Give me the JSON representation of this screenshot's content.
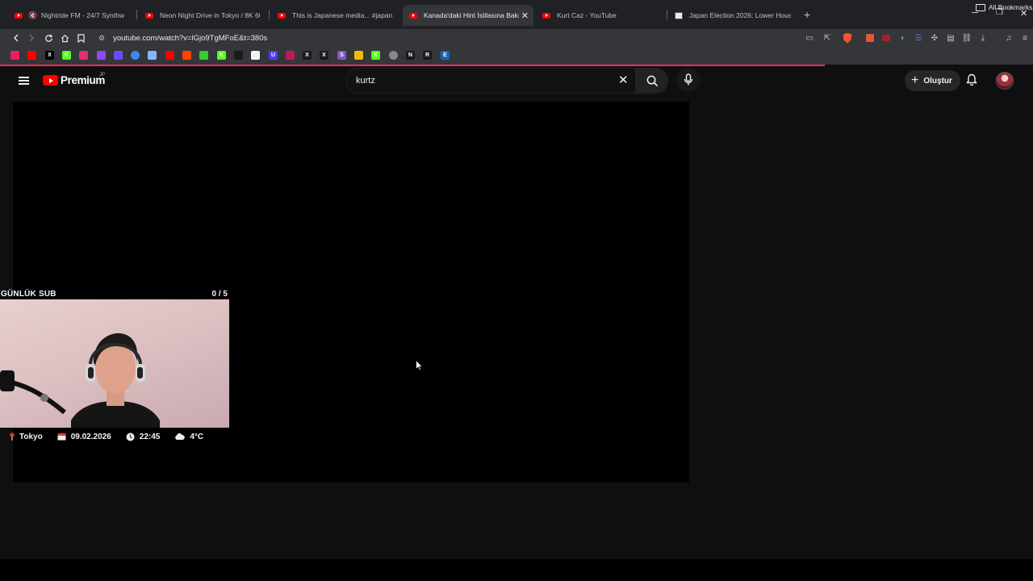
{
  "browser": {
    "tabs": [
      {
        "title": "Nightride FM - 24/7 Synthwave R",
        "muted": true
      },
      {
        "title": "Neon Night Drive in Tokyo / 8K 60fps"
      },
      {
        "title": "This is Japanese media... #japan #jap"
      },
      {
        "title": "Kanada'daki Hint İstilasına Bakış",
        "active": true
      },
      {
        "title": "Kurt Caz - YouTube"
      },
      {
        "title": "Japan Election 2026: Lower House Ele"
      }
    ],
    "url": "youtube.com/watch?v=lGjo9TgMFoE&t=380s",
    "all_bookmarks_label": "All Bookmarks",
    "bookmark_icons": [
      "youtube-music-icon",
      "youtube-icon",
      "x-icon",
      "kick-icon",
      "instagram-icon",
      "twitch-icon",
      "proton-mail-icon",
      "chrome-icon",
      "sparkle-icon",
      "youtube-icon",
      "reddit-icon",
      "drop-icon",
      "kick-icon",
      "terminal-icon",
      "diamond-icon",
      "u-icon",
      "chat-icon",
      "x-icon",
      "x-icon",
      "s-icon",
      "crypto-icon",
      "k-icon",
      "globe-icon",
      "n-icon",
      "r-icon",
      "e-icon"
    ]
  },
  "youtube": {
    "logo_text": "Premium",
    "region": "JP",
    "search_value": "kurtz",
    "create_label": "Oluştur"
  },
  "overlay": {
    "title": "GÜNLÜK SUB",
    "count": "0 / 5",
    "location": "Tokyo",
    "date": "09.02.2026",
    "time": "22:45",
    "temperature": "4°C"
  },
  "colors": {
    "accent": "#ff0000",
    "load_bar": "#ff2d55",
    "background": "#0f0f0f"
  }
}
